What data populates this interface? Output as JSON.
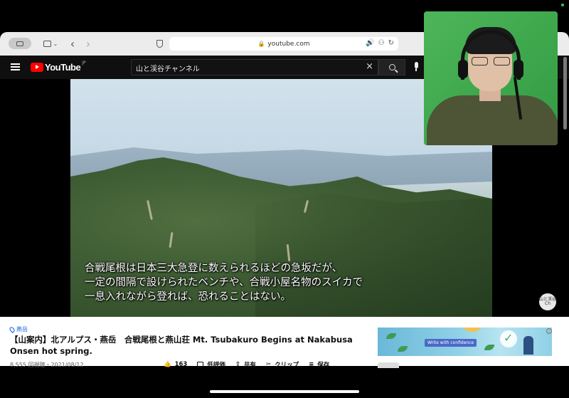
{
  "browser": {
    "url": "youtube.com"
  },
  "youtube": {
    "logo_text": "YouTube",
    "region": "JP",
    "search_query": "山と渓谷チャンネル"
  },
  "video": {
    "subtitles": [
      "合戦尾根は日本三大急登に数えられるほどの急坂だが、",
      "一定の間隔で設けられたベンチや、合戦小屋名物のスイカで",
      "一息入れながら登れば、恐れることはない。"
    ],
    "watermark": "山と渓谷 Ch"
  },
  "info": {
    "hashtag": "燕岳",
    "title": "【山案内】北アルプス・燕岳　合戦尾根と燕山荘 Mt. Tsubakuro Begins at Nakabusa Onsen hot spring.",
    "meta": "8,555 回視聴・2021/08/12",
    "actions": {
      "likes": "163",
      "dislike": "低評価",
      "share": "共有",
      "clip": "クリップ",
      "save": "保存"
    },
    "ad_text": "Write with confidence"
  },
  "colors": {
    "youtube_red": "#ff0000",
    "header_bg": "#0f0f0f",
    "link_blue": "#065fd4",
    "greenscreen": "#3fa84d"
  }
}
